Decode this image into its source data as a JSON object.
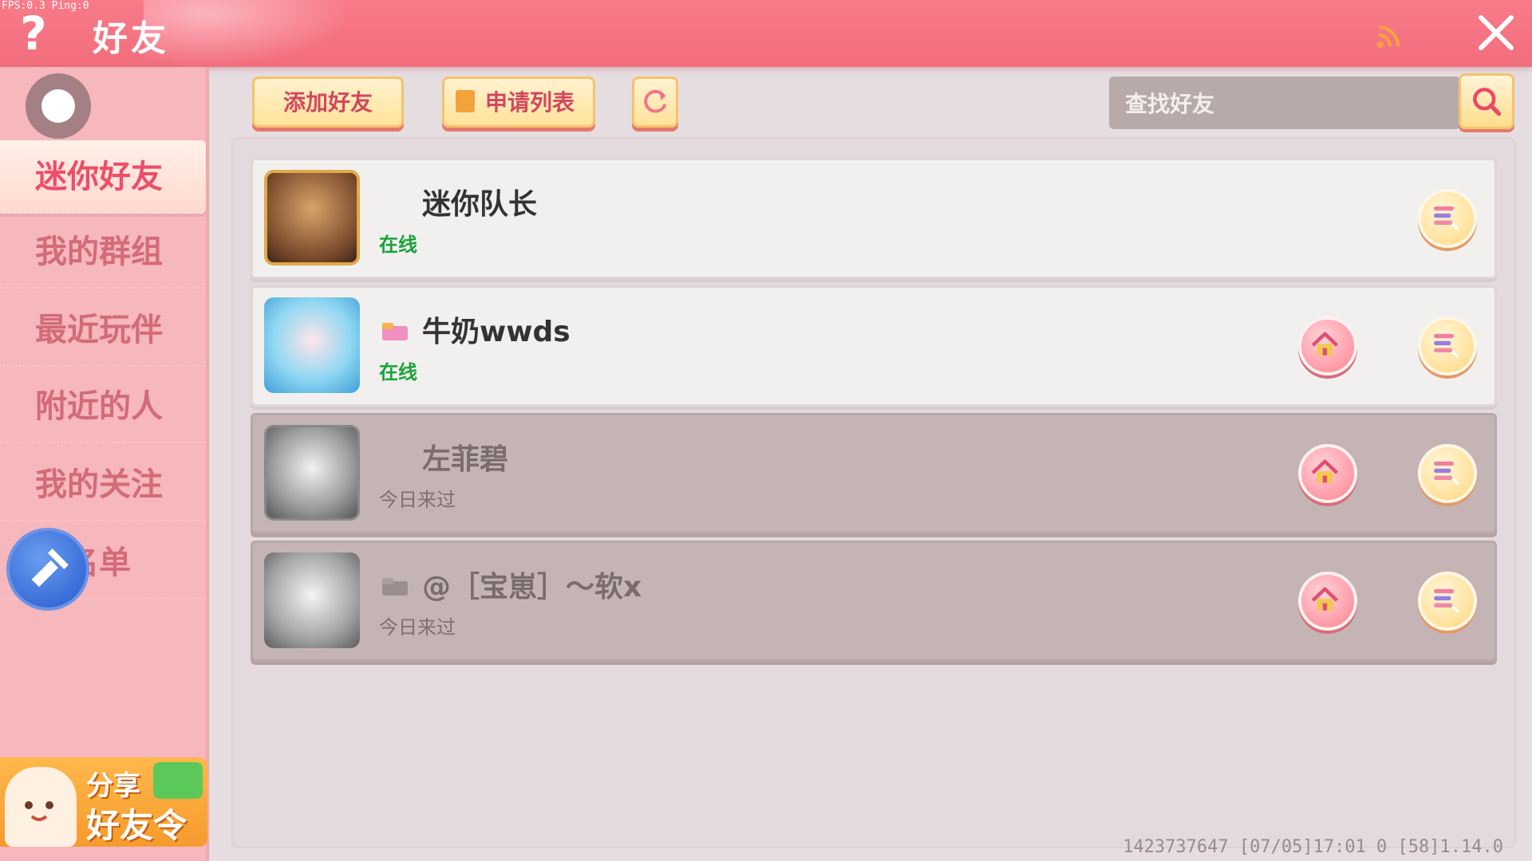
{
  "debug": {
    "fps_ping": "FPS:0.3 Ping:0"
  },
  "header": {
    "help_symbol": "?",
    "title": "好友",
    "icons": {
      "rss": "rss-feed-icon",
      "close": "close-icon"
    }
  },
  "sidebar": {
    "items": [
      {
        "label": "迷你好友",
        "active": true
      },
      {
        "label": "我的群组",
        "active": false
      },
      {
        "label": "最近玩伴",
        "active": false
      },
      {
        "label": "附近的人",
        "active": false
      },
      {
        "label": "我的关注",
        "active": false
      },
      {
        "label": "黑名单",
        "active": false
      }
    ],
    "share_banner": {
      "line1": "分享",
      "line2": "好友令"
    }
  },
  "toolbar": {
    "add_friend_label": "添加好友",
    "apply_list_label": "申请列表",
    "search_placeholder": "查找好友"
  },
  "friends": [
    {
      "name": "迷你队长",
      "status": "在线",
      "online": true,
      "has_home": false
    },
    {
      "name": "牛奶wwds",
      "status": "在线",
      "online": true,
      "has_home": true
    },
    {
      "name": "左菲碧",
      "status": "今日来过",
      "online": false,
      "has_home": true
    },
    {
      "name": "@［宝崽］～软x",
      "status": "今日来过",
      "online": false,
      "has_home": true
    }
  ],
  "footer": {
    "info": "1423737647  [07/05]17:01 0  [58]1.14.0"
  },
  "colors": {
    "header": "#f26d7c",
    "sidebar": "#f6b7bd",
    "online_status": "#19a33a",
    "accent_text": "#d2475f"
  }
}
